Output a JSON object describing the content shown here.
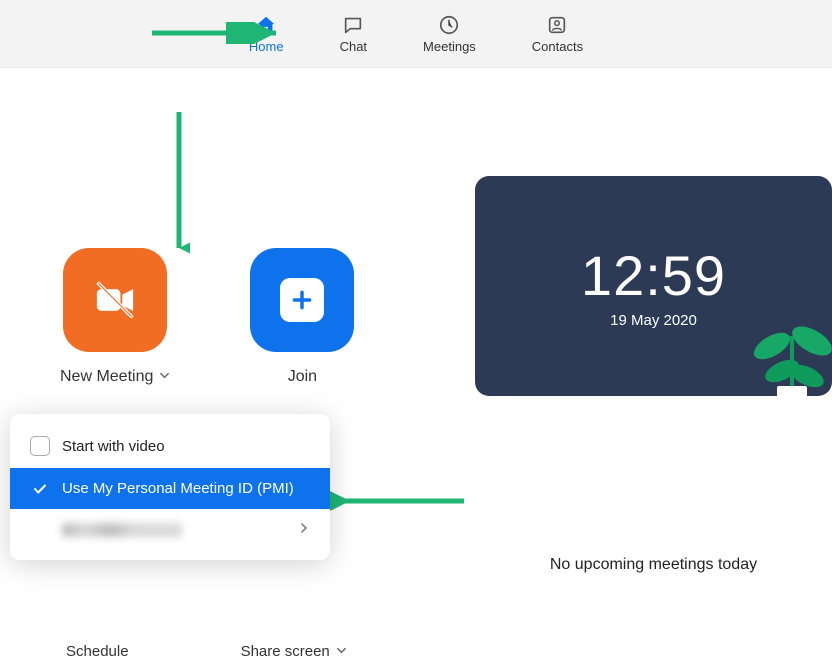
{
  "tabs": {
    "home": "Home",
    "chat": "Chat",
    "meetings": "Meetings",
    "contacts": "Contacts"
  },
  "actions": {
    "new_meeting": "New Meeting",
    "join": "Join",
    "schedule": "Schedule",
    "share_screen": "Share screen"
  },
  "dropdown": {
    "start_with_video": "Start with video",
    "use_pmi": "Use My Personal Meeting ID (PMI)"
  },
  "clock": {
    "time": "12:59",
    "date": "19 May 2020"
  },
  "upcoming": {
    "empty": "No upcoming meetings today"
  }
}
